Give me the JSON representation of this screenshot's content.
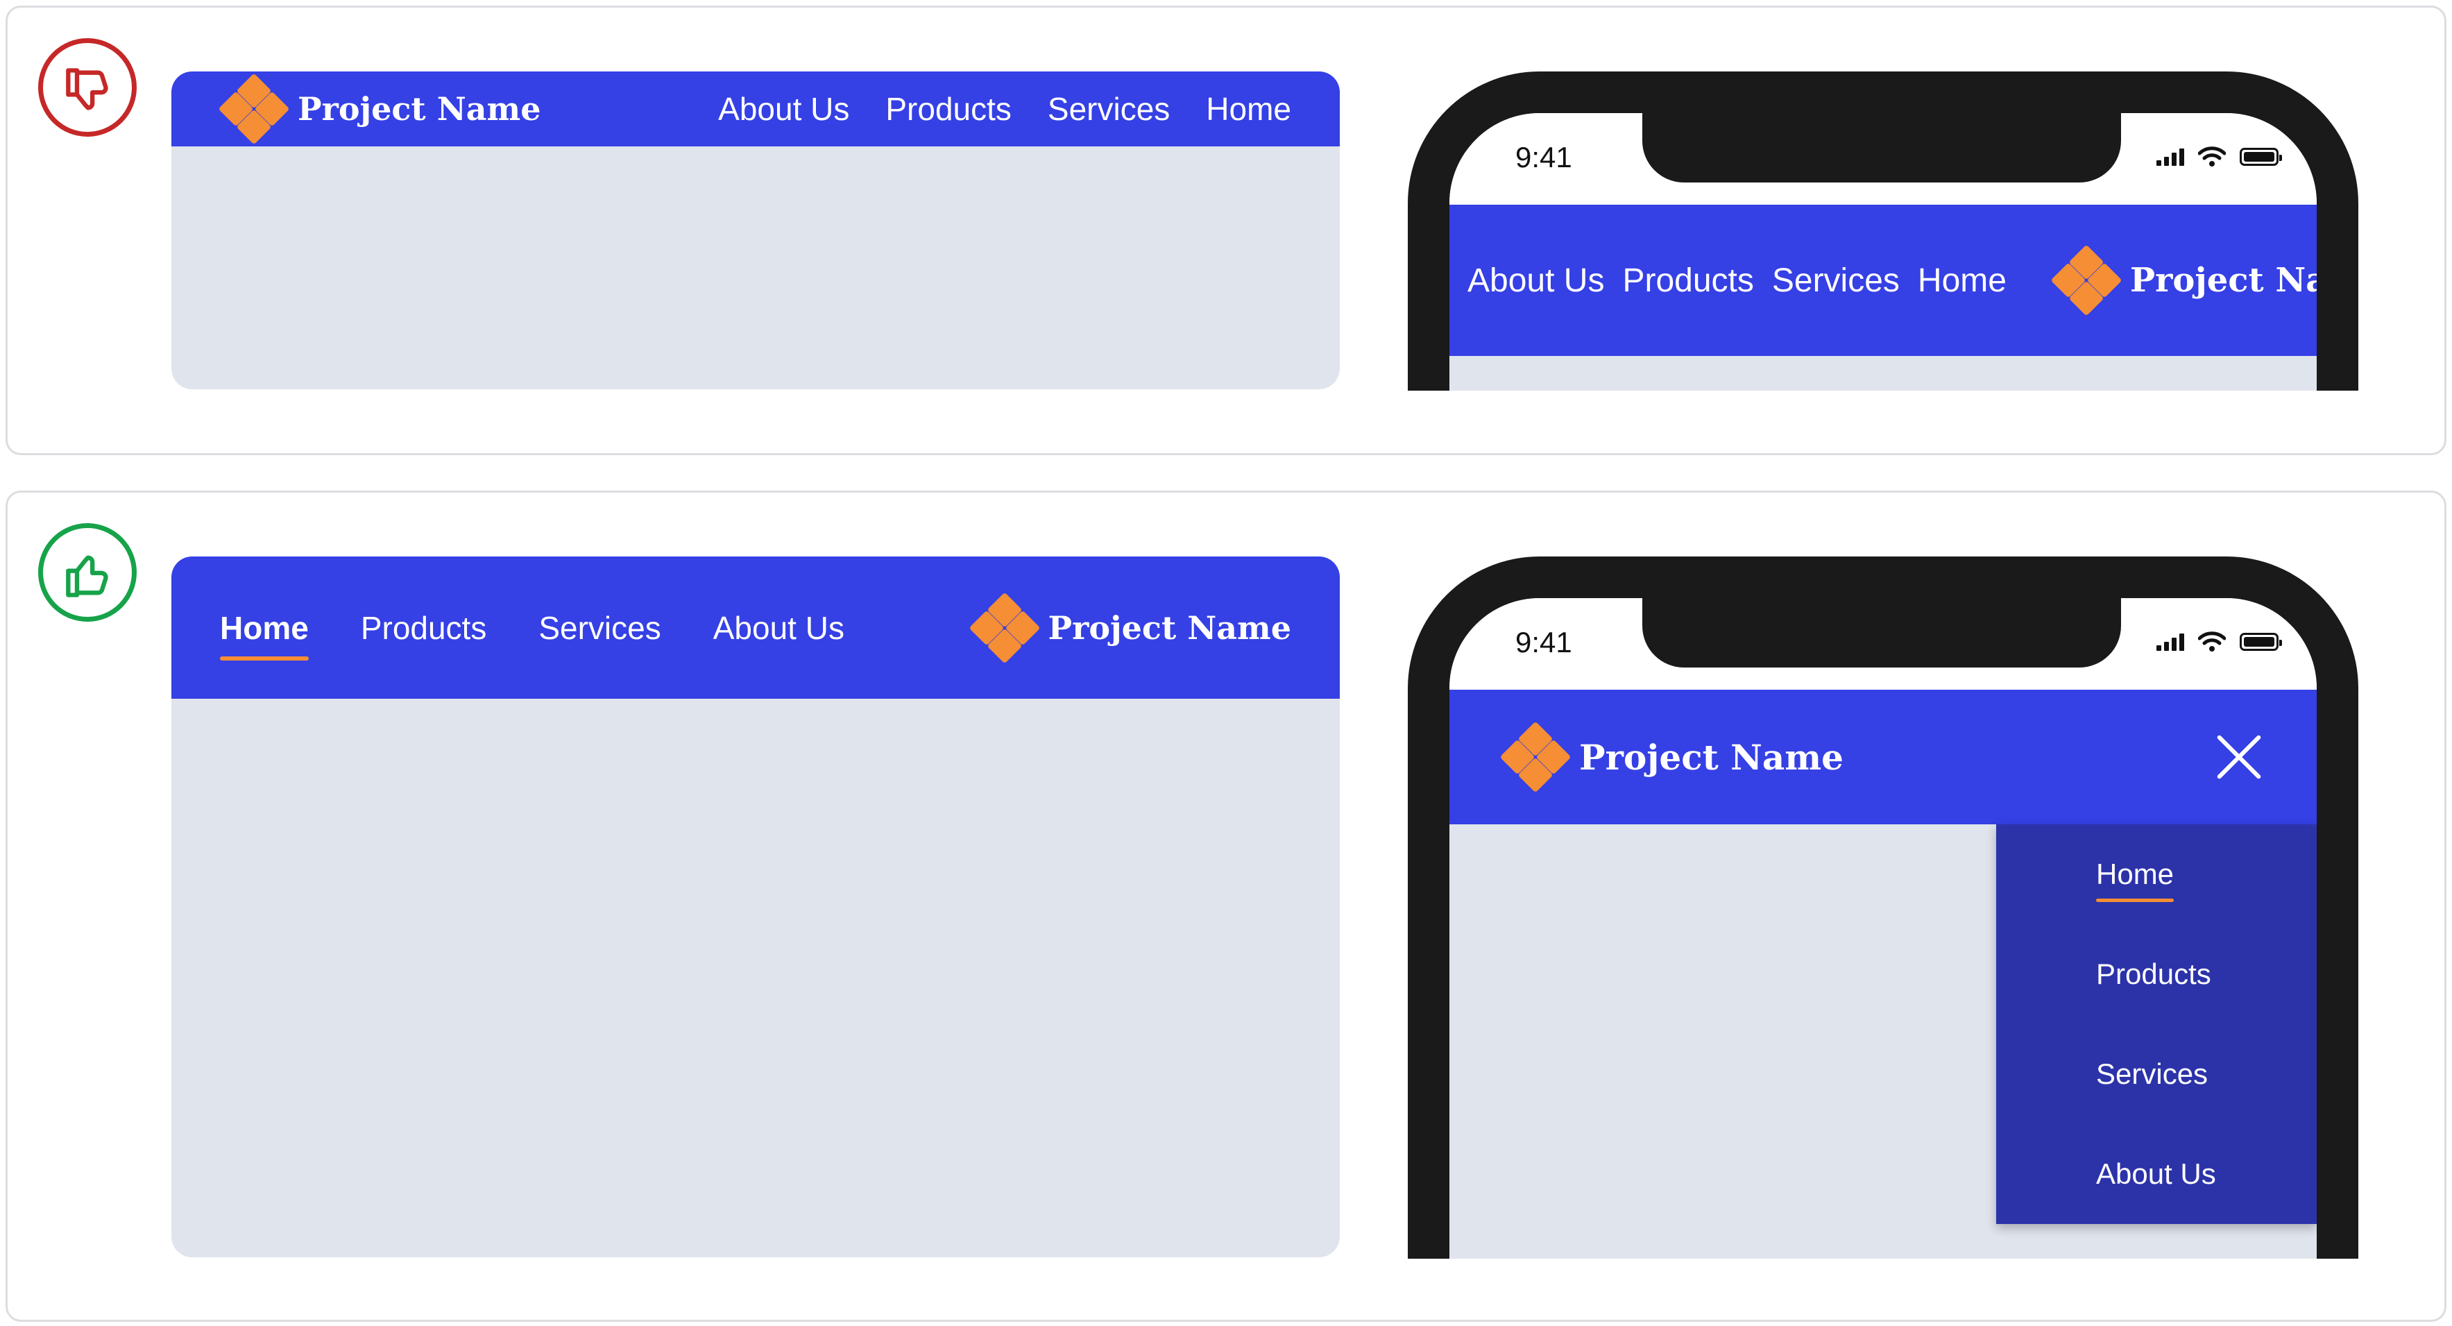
{
  "brand": {
    "name": "Project Name",
    "logo_icon": "diamond-cluster-logo",
    "accent": "#f58e34",
    "bar_color": "#3540e5"
  },
  "bad_example": {
    "verdict_icon": "thumbs-down-icon",
    "verdict_color": "#c62828",
    "desktop_nav": [
      "About Us",
      "Products",
      "Services",
      "Home"
    ],
    "mobile": {
      "time": "9:41",
      "nav": [
        "About Us",
        "Products",
        "Services",
        "Home"
      ]
    }
  },
  "good_example": {
    "verdict_icon": "thumbs-up-icon",
    "verdict_color": "#16a34a",
    "desktop_nav": [
      "Home",
      "Products",
      "Services",
      "About Us"
    ],
    "active_item": "Home",
    "mobile": {
      "time": "9:41",
      "close_icon": "close-icon",
      "menu": [
        "Home",
        "Products",
        "Services",
        "About Us"
      ],
      "drawer_color": "#2c33a8"
    }
  }
}
